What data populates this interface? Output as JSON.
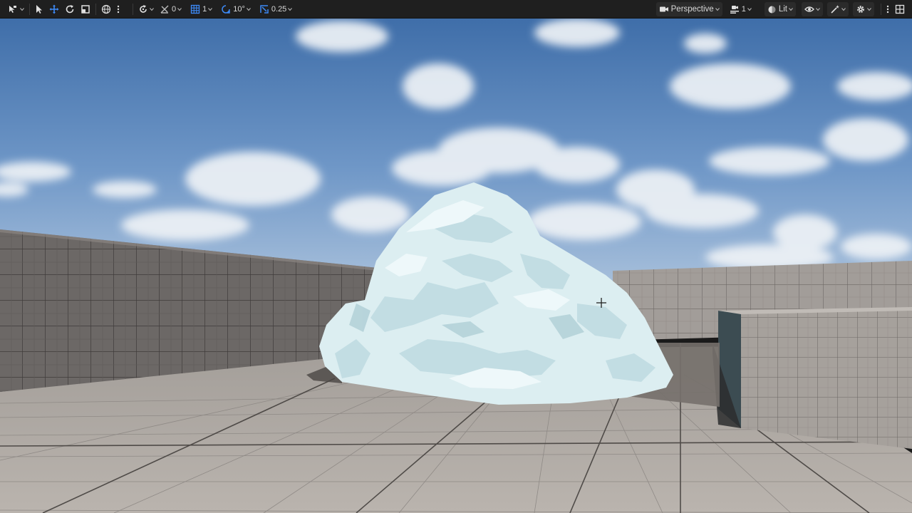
{
  "toolbar": {
    "left": {
      "select_mode_icon": "select-mode-icon",
      "tools": [
        "select-arrow-icon",
        "move-icon",
        "rotate-icon",
        "scale-icon",
        "world-icon",
        "more-icon"
      ],
      "snap_rotate_label": "",
      "surface_snap_value": "0",
      "grid_snap_value": "1",
      "rotation_snap_value": "10°",
      "scale_snap_value": "0.25"
    },
    "right": {
      "view_mode_label": "Perspective",
      "camera_speed_value": "1",
      "lighting_label": "Lit"
    }
  },
  "viewport": {
    "sky_color": "#4a7ab5",
    "floor_color": "#b0aaa6",
    "wall_color": "#6e6a68",
    "ice_color": "#dcedf0"
  }
}
